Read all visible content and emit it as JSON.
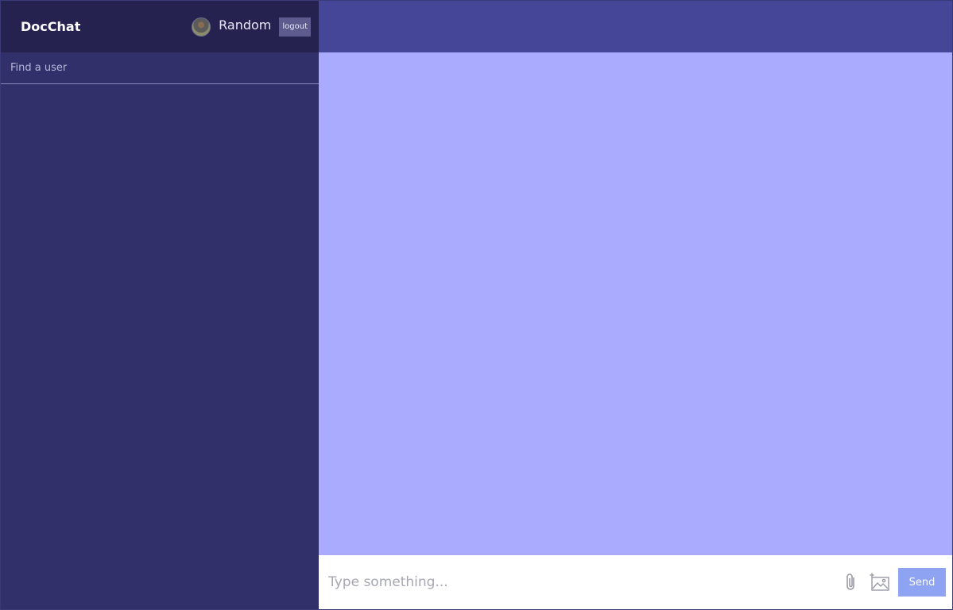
{
  "app": {
    "name": "DocChat"
  },
  "user": {
    "name": "Random",
    "logout_label": "logout"
  },
  "search": {
    "placeholder": "Find a user"
  },
  "composer": {
    "placeholder": "Type something...",
    "send_label": "Send"
  },
  "icons": {
    "attach": "paperclip-icon",
    "image": "add-image-icon"
  },
  "colors": {
    "sidebar": "#32306b",
    "navbar": "#252250",
    "chat_header": "#464699",
    "messages_bg": "#aaaafe",
    "send_button": "#8ea4f3"
  }
}
